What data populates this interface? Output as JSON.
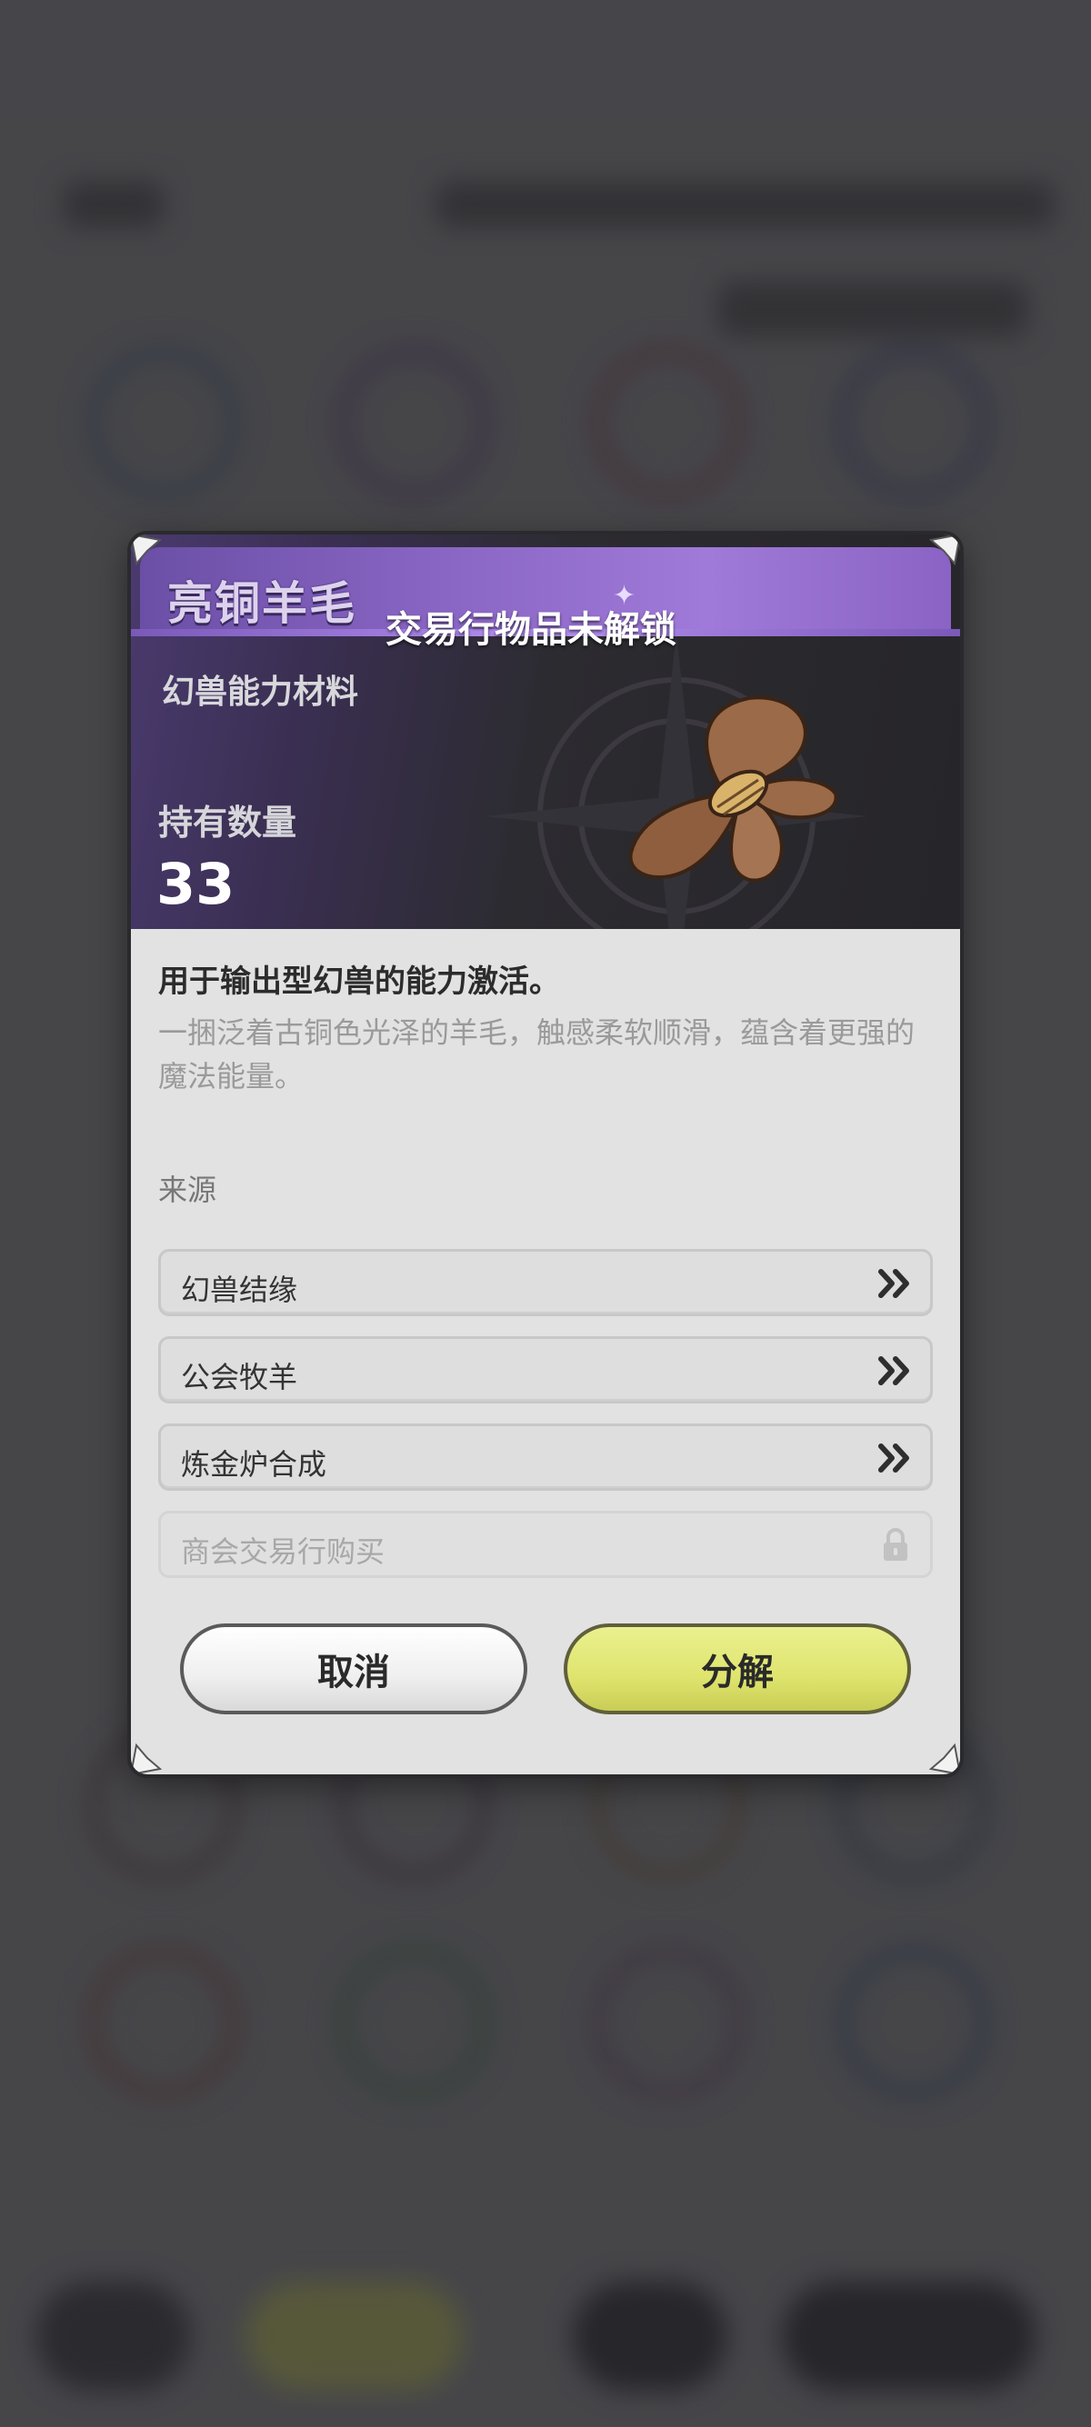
{
  "dialog": {
    "item_name": "亮铜羊毛",
    "trade_status": "交易行物品未解锁",
    "category": "幻兽能力材料",
    "owned_label": "持有数量",
    "owned_count": "33",
    "usage": "用于输出型幻兽的能力激活。",
    "description": "一捆泛着古铜色光泽的羊毛，触感柔软顺滑，蕴含着更强的魔法能量。",
    "source_title": "来源",
    "sources": [
      {
        "label": "幻兽结缘",
        "icon": "double-chevron-right-icon",
        "locked": false
      },
      {
        "label": "公会牧羊",
        "icon": "double-chevron-right-icon",
        "locked": false
      },
      {
        "label": "炼金炉合成",
        "icon": "double-chevron-right-icon",
        "locked": false
      },
      {
        "label": "商会交易行购买",
        "icon": "lock-icon",
        "locked": true
      }
    ],
    "cancel_label": "取消",
    "confirm_label": "分解"
  },
  "colors": {
    "title_band": "#8b67c6",
    "confirm_button": "#dfe46e",
    "dialog_bg": "#e2e2e2",
    "header_dark": "#262529"
  }
}
